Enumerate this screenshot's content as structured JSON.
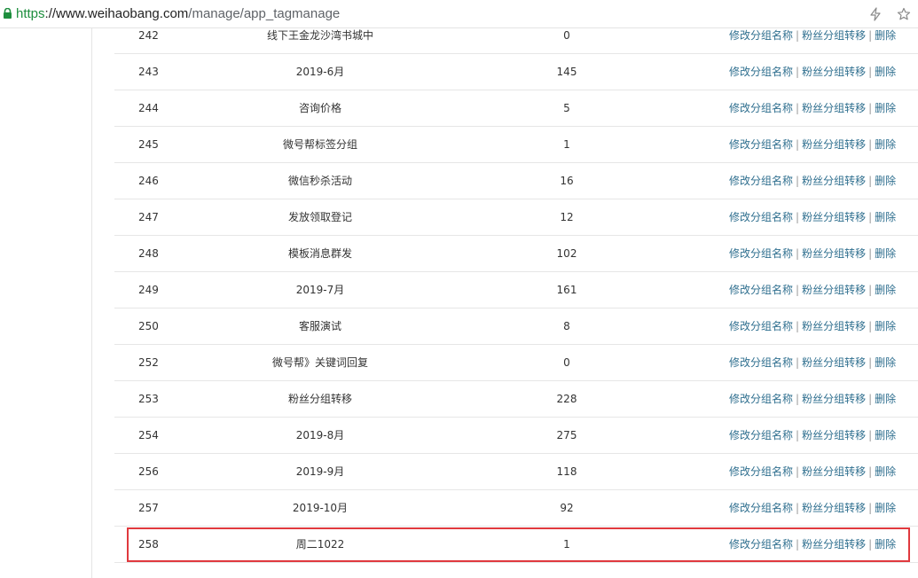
{
  "browser": {
    "url_scheme": "https",
    "url_host": "://www.weihaobang.com",
    "url_path": "/manage/app_tagmanage"
  },
  "table": {
    "action_rename": "修改分组名称",
    "action_transfer": "粉丝分组转移",
    "action_delete": "删除",
    "separator": "|",
    "rows": [
      {
        "id": "242",
        "name": "线下王金龙沙湾书城中",
        "count": "0"
      },
      {
        "id": "243",
        "name": "2019-6月",
        "count": "145"
      },
      {
        "id": "244",
        "name": "咨询价格",
        "count": "5"
      },
      {
        "id": "245",
        "name": "微号帮标签分组",
        "count": "1"
      },
      {
        "id": "246",
        "name": "微信秒杀活动",
        "count": "16"
      },
      {
        "id": "247",
        "name": "发放领取登记",
        "count": "12"
      },
      {
        "id": "248",
        "name": "模板消息群发",
        "count": "102"
      },
      {
        "id": "249",
        "name": "2019-7月",
        "count": "161"
      },
      {
        "id": "250",
        "name": "客服演试",
        "count": "8"
      },
      {
        "id": "252",
        "name": "微号帮》关键词回复",
        "count": "0"
      },
      {
        "id": "253",
        "name": "粉丝分组转移",
        "count": "228"
      },
      {
        "id": "254",
        "name": "2019-8月",
        "count": "275"
      },
      {
        "id": "256",
        "name": "2019-9月",
        "count": "118"
      },
      {
        "id": "257",
        "name": "2019-10月",
        "count": "92"
      },
      {
        "id": "258",
        "name": "周二1022",
        "count": "1"
      }
    ]
  },
  "colors": {
    "link": "#2f6f8f",
    "highlight": "#e0393e",
    "lock": "#1e8e3e"
  },
  "icons": [
    "lock-icon",
    "bolt-icon",
    "star-icon"
  ]
}
